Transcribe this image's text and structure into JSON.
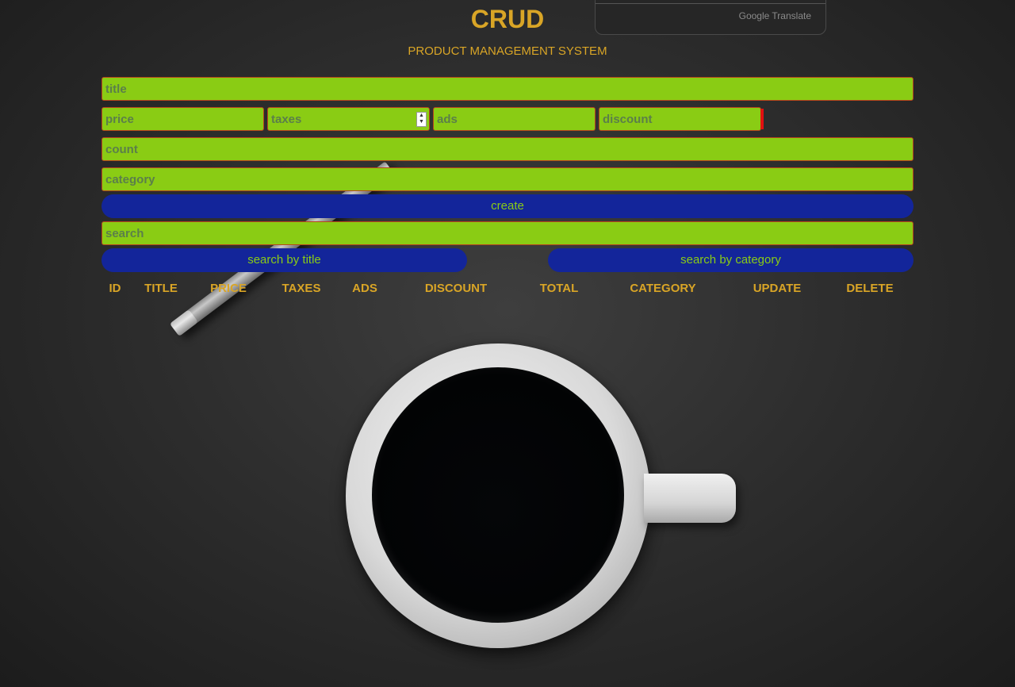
{
  "header": {
    "title": "CRUD",
    "subtitle": "PRODUCT MANAGEMENT SYSTEM"
  },
  "translate_widget": {
    "brand": "Google Translate"
  },
  "form": {
    "title_placeholder": "title",
    "price_placeholder": "price",
    "taxes_placeholder": "taxes",
    "ads_placeholder": "ads",
    "discount_placeholder": "discount",
    "count_placeholder": "count",
    "category_placeholder": "category",
    "create_label": "create",
    "search_placeholder": "search",
    "search_title_label": "search by title",
    "search_category_label": "search by category"
  },
  "table": {
    "columns": [
      "ID",
      "TITLE",
      "PRICE",
      "TAXES",
      "ADS",
      "DISCOUNT",
      "TOTAL",
      "CATEGORY",
      "UPDATE",
      "DELETE"
    ],
    "rows": []
  },
  "colors": {
    "accent": "#d9a526",
    "input_bg": "#8acc14",
    "button_bg": "#13259a",
    "error_marker": "#e01010"
  },
  "icons": {
    "spinner": "number-stepper-icon"
  }
}
